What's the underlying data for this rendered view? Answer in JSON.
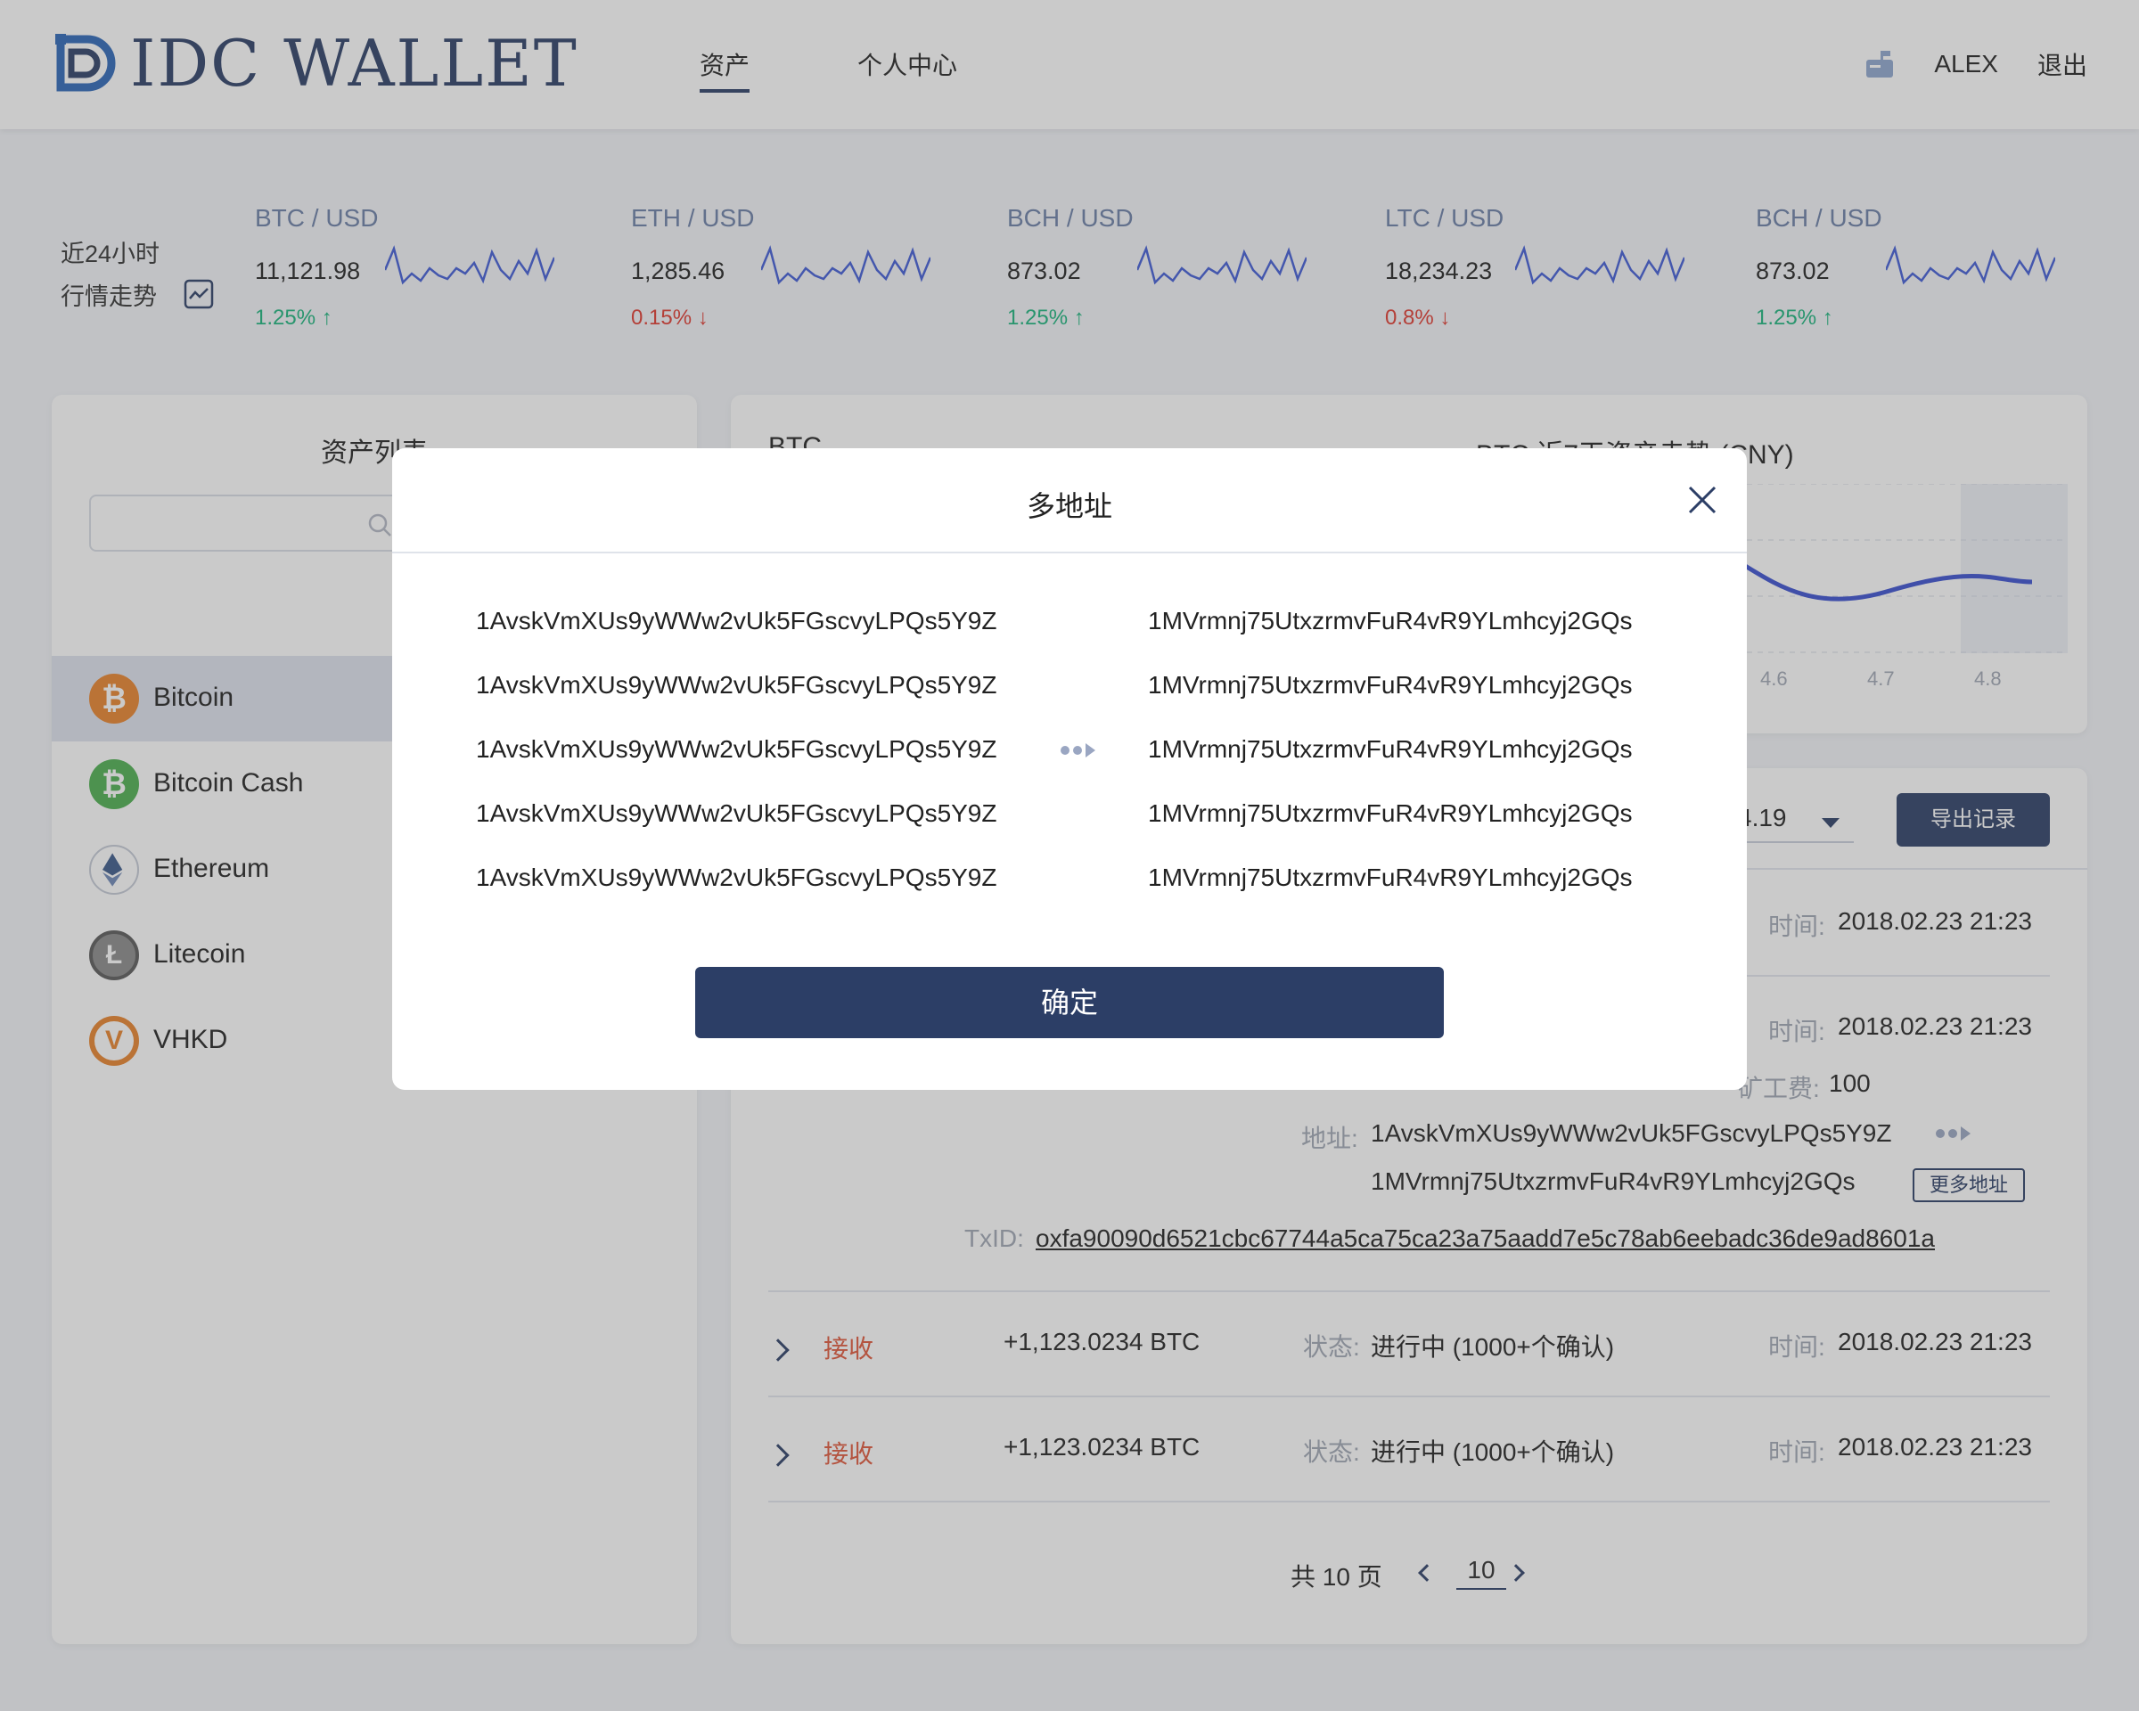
{
  "header": {
    "logo_text": "IDC WALLET",
    "nav": [
      {
        "label": "资产",
        "active": true
      },
      {
        "label": "个人中心",
        "active": false
      }
    ],
    "user": "ALEX",
    "logout": "退出"
  },
  "ticker": {
    "title_line1": "近24小时",
    "title_line2": "行情走势",
    "items": [
      {
        "pair": "BTC / USD",
        "price": "11,121.98",
        "change": "1.25%",
        "dir": "up",
        "arrow": "↑"
      },
      {
        "pair": "ETH / USD",
        "price": "1,285.46",
        "change": "0.15%",
        "dir": "down",
        "arrow": "↓"
      },
      {
        "pair": "BCH / USD",
        "price": "873.02",
        "change": "1.25%",
        "dir": "up",
        "arrow": "↑"
      },
      {
        "pair": "LTC / USD",
        "price": "18,234.23",
        "change": "0.8%",
        "dir": "down",
        "arrow": "↓"
      },
      {
        "pair": "BCH / USD",
        "price": "873.02",
        "change": "1.25%",
        "dir": "up",
        "arrow": "↑"
      }
    ]
  },
  "assets": {
    "title": "资产列表",
    "search_placeholder": "搜",
    "items": [
      {
        "name": "Bitcoin",
        "color": "#e8832b",
        "glyph": "₿",
        "active": true
      },
      {
        "name": "Bitcoin Cash",
        "color": "#4caf50",
        "glyph": "₿",
        "active": false
      },
      {
        "name": "Ethereum",
        "color": "#ffffff",
        "glyph": "◆",
        "active": false
      },
      {
        "name": "Litecoin",
        "color": "#8a8a8a",
        "glyph": "Ł",
        "active": false
      },
      {
        "name": "VHKD",
        "color": "#e8832b",
        "glyph": "V",
        "active": false
      }
    ]
  },
  "overview": {
    "coin": "BTC",
    "chart_title": "BTC 近7天资产走势 (CNY)",
    "x_labels": [
      "4.6",
      "4.7",
      "4.8"
    ]
  },
  "records": {
    "date_value": "4.19",
    "export_label": "导出记录",
    "time_label": "时间:",
    "time_value": "2018.02.23 21:23",
    "fee_label": "矿工费:",
    "fee_value": "100",
    "addr_label": "地址:",
    "addr1": "1AvskVmXUs9yWWw2vUk5FGscvyLPQs5Y9Z",
    "addr2": "1MVrmnj75UtxzrmvFuR4vR9YLmhcyj2GQs",
    "more_label": "更多地址",
    "txid_label": "TxID:",
    "txid_value": "oxfa90090d6521cbc67744a5ca75ca23a75aadd7e5c78ab6eebadc36de9ad8601a",
    "rows": [
      {
        "type": "接收",
        "amount": "+1,123.0234 BTC",
        "status_label": "状态:",
        "status": "进行中 (1000+个确认)",
        "time_label": "时间:",
        "time": "2018.02.23 21:23"
      },
      {
        "type": "接收",
        "amount": "+1,123.0234 BTC",
        "status_label": "状态:",
        "status": "进行中 (1000+个确认)",
        "time_label": "时间:",
        "time": "2018.02.23 21:23"
      }
    ],
    "pager_total": "共 10 页",
    "pager_current": "10"
  },
  "modal": {
    "title": "多地址",
    "left": [
      "1AvskVmXUs9yWWw2vUk5FGscvyLPQs5Y9Z",
      "1AvskVmXUs9yWWw2vUk5FGscvyLPQs5Y9Z",
      "1AvskVmXUs9yWWw2vUk5FGscvyLPQs5Y9Z",
      "1AvskVmXUs9yWWw2vUk5FGscvyLPQs5Y9Z",
      "1AvskVmXUs9yWWw2vUk5FGscvyLPQs5Y9Z"
    ],
    "right": [
      "1MVrmnj75UtxzrmvFuR4vR9YLmhcyj2GQs",
      "1MVrmnj75UtxzrmvFuR4vR9YLmhcyj2GQs",
      "1MVrmnj75UtxzrmvFuR4vR9YLmhcyj2GQs",
      "1MVrmnj75UtxzrmvFuR4vR9YLmhcyj2GQs",
      "1MVrmnj75UtxzrmvFuR4vR9YLmhcyj2GQs"
    ],
    "confirm": "确定"
  },
  "colors": {
    "brand": "#2c3e66",
    "up": "#19b37b",
    "down": "#e0382e",
    "receive": "#e0563a"
  }
}
